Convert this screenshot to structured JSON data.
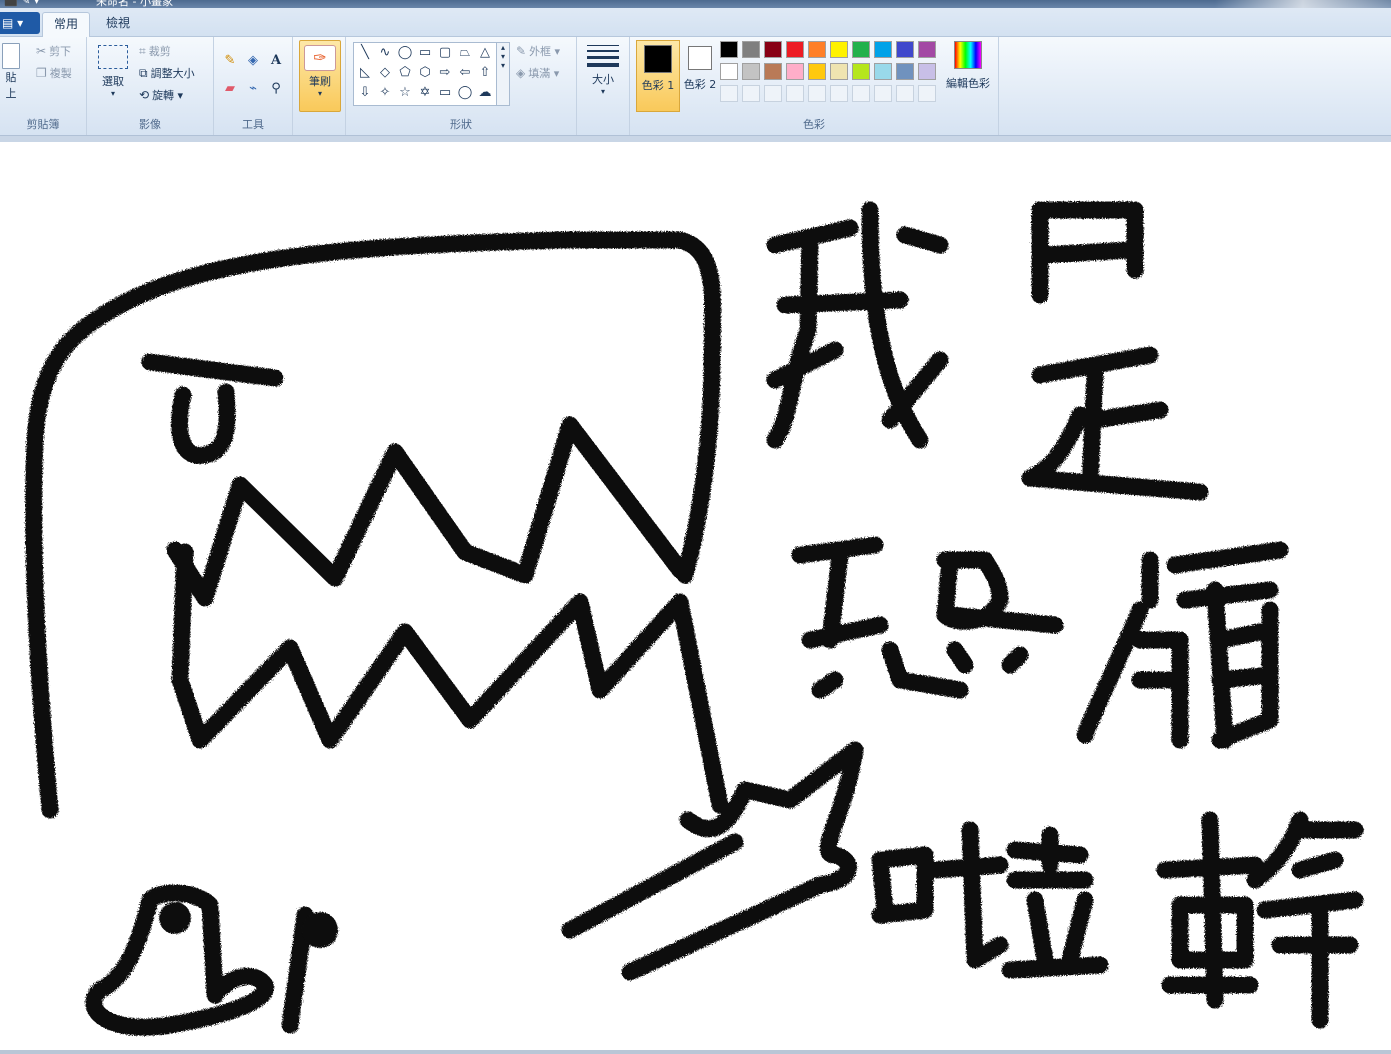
{
  "titlebar": {
    "quick_access": "⬛ ✎ ▾",
    "title": "未命名 - 小畫家"
  },
  "tabs": {
    "file_label": "▤ ▾",
    "home": "常用",
    "view": "檢視"
  },
  "clipboard": {
    "paste": "貼",
    "paste2": "上",
    "cut": "剪下",
    "copy": "複製",
    "group": "剪貼簿"
  },
  "image": {
    "select": "選取",
    "crop": "裁剪",
    "resize": "調整大小",
    "rotate": "旋轉",
    "group": "影像"
  },
  "tools": {
    "group": "工具"
  },
  "brushes": {
    "label": "筆刷"
  },
  "shapes": {
    "outline": "外框",
    "fill": "填滿",
    "group": "形狀"
  },
  "size": {
    "label": "大小"
  },
  "colors": {
    "color1": "色彩 1",
    "color2": "色彩 2",
    "edit": "編輯色彩",
    "group": "色彩",
    "palette_row1": [
      "#000000",
      "#7f7f7f",
      "#880015",
      "#ed1c24",
      "#ff7f27",
      "#fff200",
      "#22b14c",
      "#00a2e8",
      "#3f48cc",
      "#a349a4"
    ],
    "palette_row2": [
      "#ffffff",
      "#c3c3c3",
      "#b97a57",
      "#ffaec9",
      "#ffc90e",
      "#efe4b0",
      "#b5e61d",
      "#99d9ea",
      "#7092be",
      "#c8bfe7"
    ]
  },
  "drawing": {
    "line1": "我是",
    "line2": "恐龍",
    "line3": "啦幹"
  }
}
